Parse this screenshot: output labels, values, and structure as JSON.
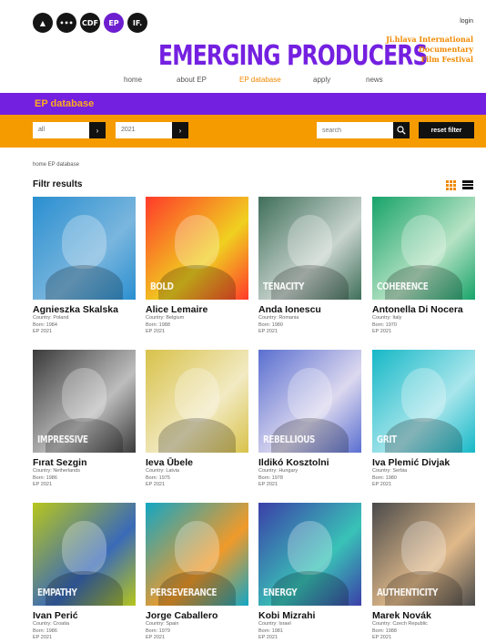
{
  "header": {
    "top_icons": [
      "▲",
      "•••",
      "CDF",
      "EP",
      "IF."
    ],
    "login": "login",
    "logo": "EMERGING PRODUCERS",
    "festival_lines": [
      "Ji.hlava International",
      "Documentary",
      "Film Festival"
    ]
  },
  "nav": [
    {
      "label": "home",
      "active": false
    },
    {
      "label": "about EP",
      "active": false
    },
    {
      "label": "EP database",
      "active": true
    },
    {
      "label": "apply",
      "active": false
    },
    {
      "label": "news",
      "active": false
    }
  ],
  "banner": {
    "title": "EP database",
    "filter_country": "all",
    "filter_year": "2021",
    "search_placeholder": "search",
    "reset_label": "reset filter"
  },
  "breadcrumb": "home  EP database",
  "section_title": "Filtr results",
  "colors": {
    "purple": "#7420e0",
    "orange": "#f59b00"
  },
  "producers": [
    {
      "name": "Agnieszka Skalska",
      "country": "Country: Poland",
      "born": "Born: 1984",
      "ep": "EP 2021",
      "word": "",
      "c1": "#2a8fd0",
      "c2": "#7ab6de"
    },
    {
      "name": "Alice Lemaire",
      "country": "Country: Belgium",
      "born": "Born: 1988",
      "ep": "EP 2021",
      "word": "BOLD",
      "c1": "#ff3a2a",
      "c2": "#f0d020"
    },
    {
      "name": "Anda Ionescu",
      "country": "Country: Romania",
      "born": "Born: 1980",
      "ep": "EP 2021",
      "word": "TENACITY",
      "c1": "#3f6f5a",
      "c2": "#c9d4cf"
    },
    {
      "name": "Antonella Di Nocera",
      "country": "Country: Italy",
      "born": "Born: 1970",
      "ep": "EP 2021",
      "word": "COHERENCE",
      "c1": "#17a36a",
      "c2": "#b7e3c4"
    },
    {
      "name": "Fırat Sezgin",
      "country": "Country: Netherlands",
      "born": "Born: 1986",
      "ep": "EP 2021",
      "word": "IMPRESSIVE",
      "c1": "#3a3a3a",
      "c2": "#bdbdbd"
    },
    {
      "name": "Ieva Ūbele",
      "country": "Country: Latvia",
      "born": "Born: 1975",
      "ep": "EP 2021",
      "word": "",
      "c1": "#d8c24a",
      "c2": "#f2eac3"
    },
    {
      "name": "Ildikó Kosztolni",
      "country": "Country: Hungary",
      "born": "Born: 1978",
      "ep": "EP 2021",
      "word": "REBELLIOUS",
      "c1": "#5a6fd0",
      "c2": "#dcd8ef"
    },
    {
      "name": "Iva Plemić Divjak",
      "country": "Country: Serbia",
      "born": "Born: 1980",
      "ep": "EP 2021",
      "word": "GRIT",
      "c1": "#16b8c7",
      "c2": "#a9e6ec"
    },
    {
      "name": "Ivan Perić",
      "country": "Country: Croatia",
      "born": "Born: 1986",
      "ep": "EP 2021",
      "word": "EMPATHY",
      "c1": "#b7c61c",
      "c2": "#3a6ab8"
    },
    {
      "name": "Jorge Caballero",
      "country": "Country: Spain",
      "born": "Born: 1979",
      "ep": "EP 2021",
      "word": "PERSEVERANCE",
      "c1": "#13a6c4",
      "c2": "#f09a2a"
    },
    {
      "name": "Kobi Mizrahi",
      "country": "Country: Israel",
      "born": "Born: 1981",
      "ep": "EP 2021",
      "word": "ENERGY",
      "c1": "#3b3fa8",
      "c2": "#39c2b7"
    },
    {
      "name": "Marek Novák",
      "country": "Country: Czech Republic",
      "born": "Born: 1988",
      "ep": "EP 2021",
      "word": "AUTHENTICITY",
      "c1": "#4a4a4a",
      "c2": "#e0b98a"
    }
  ]
}
